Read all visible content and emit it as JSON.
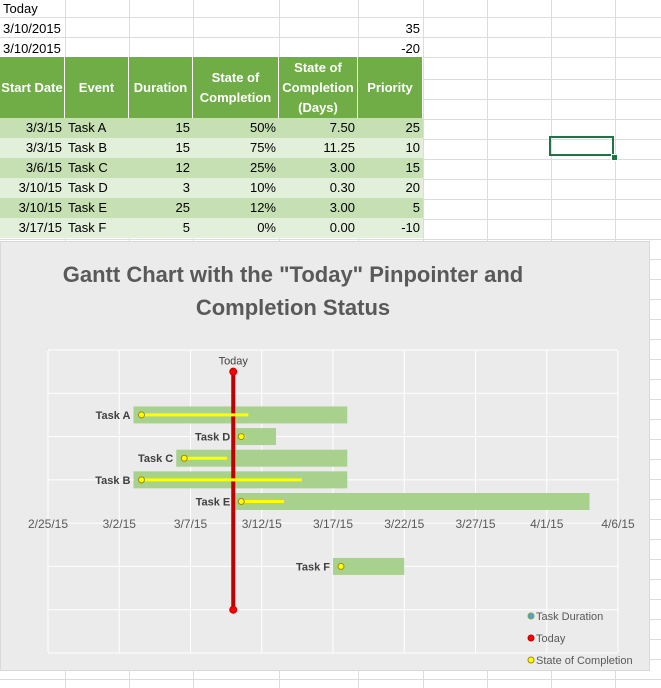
{
  "sheet": {
    "today_label": "Today",
    "today_row1": {
      "date": "3/10/2015",
      "value": "35"
    },
    "today_row2": {
      "date": "3/10/2015",
      "value": "-20"
    },
    "headers": [
      "Start Date",
      "Event",
      "Duration",
      "State of Completion",
      "State of Completion (Days)",
      "Priority"
    ],
    "header_lines": [
      [
        "Start Date"
      ],
      [
        "Event"
      ],
      [
        "Duration"
      ],
      [
        "State of",
        "Completion"
      ],
      [
        "State of",
        "Completion",
        "(Days)"
      ],
      [
        "Priority"
      ]
    ],
    "rows": [
      {
        "start": "3/3/15",
        "event": "Task A",
        "duration": "15",
        "completion": "50%",
        "days": "7.50",
        "priority": "25"
      },
      {
        "start": "3/3/15",
        "event": "Task B",
        "duration": "15",
        "completion": "75%",
        "days": "11.25",
        "priority": "10"
      },
      {
        "start": "3/6/15",
        "event": "Task C",
        "duration": "12",
        "completion": "25%",
        "days": "3.00",
        "priority": "15"
      },
      {
        "start": "3/10/15",
        "event": "Task D",
        "duration": "3",
        "completion": "10%",
        "days": "0.30",
        "priority": "20"
      },
      {
        "start": "3/10/15",
        "event": "Task E",
        "duration": "25",
        "completion": "12%",
        "days": "3.00",
        "priority": "5"
      },
      {
        "start": "3/17/15",
        "event": "Task F",
        "duration": "5",
        "completion": "0%",
        "days": "0.00",
        "priority": "-10"
      }
    ]
  },
  "colors": {
    "header_green": "#70ad47",
    "row_dark": "#c6e0b4",
    "row_light": "#e2efda",
    "bar_green": "#a9d18e",
    "today_red": "#c00000",
    "completion_yellow": "#ffff00",
    "title_gray": "#595959"
  },
  "chart_data": {
    "type": "bar",
    "title": "Gantt Chart with the \"Today\" Pinpointer and Completion Status",
    "title_lines": [
      "Gantt Chart with the \"Today\" Pinpointer and",
      "Completion Status"
    ],
    "x_ticks": [
      "2/25/15",
      "3/2/15",
      "3/7/15",
      "3/12/15",
      "3/17/15",
      "3/22/15",
      "3/27/15",
      "4/1/15",
      "4/6/15"
    ],
    "x_range": [
      "2/25/15",
      "4/6/15"
    ],
    "y_range": [
      -30,
      40
    ],
    "today": {
      "label": "Today",
      "date": "3/10/15",
      "y_from": -20,
      "y_to": 35
    },
    "tasks": [
      {
        "name": "Task A",
        "start": "3/3/15",
        "duration": 15,
        "completion_days": 7.5,
        "priority": 25
      },
      {
        "name": "Task B",
        "start": "3/3/15",
        "duration": 15,
        "completion_days": 11.25,
        "priority": 10
      },
      {
        "name": "Task C",
        "start": "3/6/15",
        "duration": 12,
        "completion_days": 3.0,
        "priority": 15
      },
      {
        "name": "Task D",
        "start": "3/10/15",
        "duration": 3,
        "completion_days": 0.3,
        "priority": 20
      },
      {
        "name": "Task E",
        "start": "3/10/15",
        "duration": 25,
        "completion_days": 3.0,
        "priority": 5
      },
      {
        "name": "Task F",
        "start": "3/17/15",
        "duration": 5,
        "completion_days": 0.0,
        "priority": -10
      }
    ],
    "legend": [
      "Task Duration",
      "Today",
      "State of Completion"
    ],
    "legend_position": "bottom-right",
    "grid": true
  }
}
